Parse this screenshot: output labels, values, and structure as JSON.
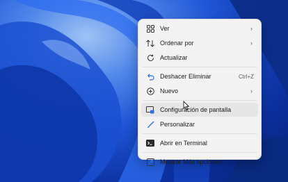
{
  "context_menu": {
    "items": [
      {
        "label": "Ver",
        "icon": "grid-icon",
        "submenu": true
      },
      {
        "label": "Ordenar por",
        "icon": "sort-icon",
        "submenu": true
      },
      {
        "label": "Actualizar",
        "icon": "refresh-icon"
      },
      {
        "label": "Deshacer Eliminar",
        "icon": "undo-icon",
        "shortcut": "Ctrl+Z"
      },
      {
        "label": "Nuevo",
        "icon": "plus-circle-icon",
        "submenu": true
      },
      {
        "label": "Configuración de pantalla",
        "icon": "display-settings-icon",
        "highlighted": true
      },
      {
        "label": "Personalizar",
        "icon": "brush-icon"
      },
      {
        "label": "Abrir en Terminal",
        "icon": "terminal-icon"
      },
      {
        "label": "Mostrar Más opciones",
        "icon": "more-options-icon"
      }
    ]
  },
  "colors": {
    "accent": "#1f55d6",
    "menu_bg": "#f3f3f3"
  }
}
